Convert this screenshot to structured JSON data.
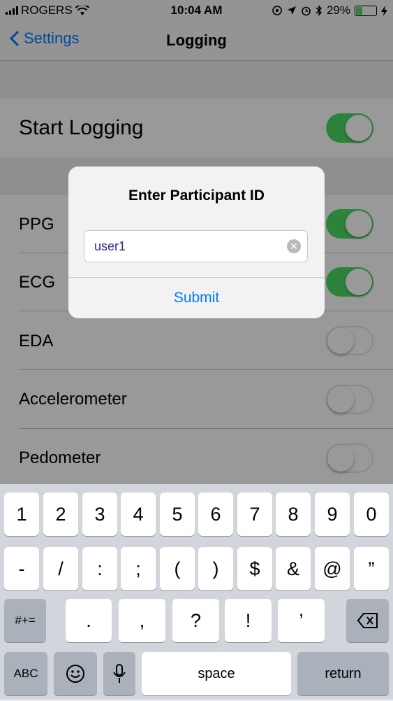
{
  "status_bar": {
    "carrier": "ROGERS",
    "time": "10:04 AM",
    "battery": "29%",
    "battery_level": 0.29
  },
  "nav": {
    "back_label": "Settings",
    "title": "Logging"
  },
  "rows": [
    {
      "label": "Start Logging",
      "on": true
    },
    {
      "label": "PPG",
      "on": true
    },
    {
      "label": "ECG",
      "on": true
    },
    {
      "label": "EDA",
      "on": false
    },
    {
      "label": "Accelerometer",
      "on": false
    },
    {
      "label": "Pedometer",
      "on": false
    }
  ],
  "alert": {
    "title": "Enter Participant ID",
    "value": "user1",
    "submit_label": "Submit"
  },
  "keyboard": {
    "row1": [
      "1",
      "2",
      "3",
      "4",
      "5",
      "6",
      "7",
      "8",
      "9",
      "0"
    ],
    "row2": [
      "-",
      "/",
      ":",
      ";",
      "(",
      ")",
      "$",
      "&",
      "@",
      "”"
    ],
    "row3_left": "#+=",
    "row3": [
      ".",
      ",",
      "?",
      "!",
      "’"
    ],
    "abc": "ABC",
    "space": "space",
    "return": "return"
  },
  "colors": {
    "accent": "#007aff",
    "toggle_on": "#4cd964",
    "battery_fill": "#4cd964"
  },
  "icons": [
    "wifi-icon",
    "location-lock-icon",
    "location-arrow-icon",
    "alarm-icon",
    "bluetooth-icon",
    "battery-icon",
    "charging-icon",
    "back-chevron-icon",
    "clear-icon",
    "backspace-icon",
    "emoji-icon",
    "microphone-icon"
  ]
}
